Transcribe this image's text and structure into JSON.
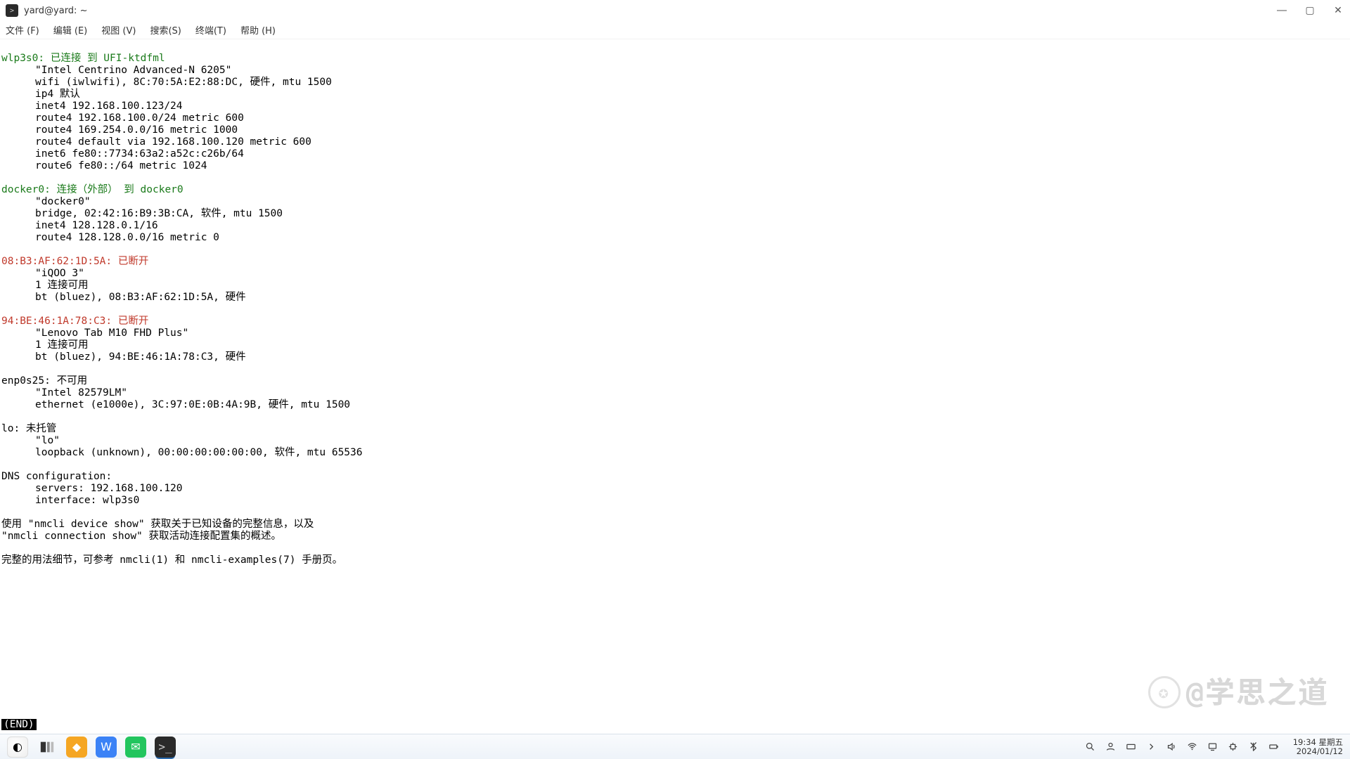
{
  "titlebar": {
    "title": "yard@yard: ~"
  },
  "menubar": {
    "file": "文件 (F)",
    "edit": "编辑 (E)",
    "view": "视图 (V)",
    "search": "搜索(S)",
    "terminal": "终端(T)",
    "help": "帮助 (H)"
  },
  "term": {
    "wlp3s0": {
      "iface": "wlp3s0:",
      "status": " 已连接 到 UFI-ktdfml",
      "l1": "\"Intel Centrino Advanced-N 6205\"",
      "l2": "wifi (iwlwifi), 8C:70:5A:E2:88:DC, 硬件, mtu 1500",
      "l3": "ip4 默认",
      "l4": "inet4 192.168.100.123/24",
      "l5": "route4 192.168.100.0/24 metric 600",
      "l6": "route4 169.254.0.0/16 metric 1000",
      "l7": "route4 default via 192.168.100.120 metric 600",
      "l8": "inet6 fe80::7734:63a2:a52c:c26b/64",
      "l9": "route6 fe80::/64 metric 1024"
    },
    "docker0": {
      "iface": "docker0:",
      "status": " 连接（外部） 到 docker0",
      "l1": "\"docker0\"",
      "l2": "bridge, 02:42:16:B9:3B:CA, 软件, mtu 1500",
      "l3": "inet4 128.128.0.1/16",
      "l4": "route4 128.128.0.0/16 metric 0"
    },
    "bt1": {
      "iface": "08:B3:AF:62:1D:5A:",
      "status": " 已断开",
      "l1": "\"iQOO 3\"",
      "l2": "1 连接可用",
      "l3": "bt (bluez), 08:B3:AF:62:1D:5A, 硬件"
    },
    "bt2": {
      "iface": "94:BE:46:1A:78:C3:",
      "status": " 已断开",
      "l1": "\"Lenovo Tab M10 FHD Plus\"",
      "l2": "1 连接可用",
      "l3": "bt (bluez), 94:BE:46:1A:78:C3, 硬件"
    },
    "enp": {
      "header": "enp0s25: 不可用",
      "l1": "\"Intel 82579LM\"",
      "l2": "ethernet (e1000e), 3C:97:0E:0B:4A:9B, 硬件, mtu 1500"
    },
    "lo": {
      "header": "lo: 未托管",
      "l1": "\"lo\"",
      "l2": "loopback (unknown), 00:00:00:00:00:00, 软件, mtu 65536"
    },
    "dns": {
      "header": "DNS configuration:",
      "l1": "servers: 192.168.100.120",
      "l2": "interface: wlp3s0"
    },
    "help1": "使用 \"nmcli device show\" 获取关于已知设备的完整信息，以及",
    "help2": "\"nmcli connection show\" 获取活动连接配置集的概述。",
    "help3": "完整的用法细节，可参考 nmcli(1) 和 nmcli-examples(7) 手册页。",
    "end": "(END)"
  },
  "watermark": "@学思之道",
  "clock": {
    "time": "19:34 星期五",
    "date": "2024/01/12"
  }
}
